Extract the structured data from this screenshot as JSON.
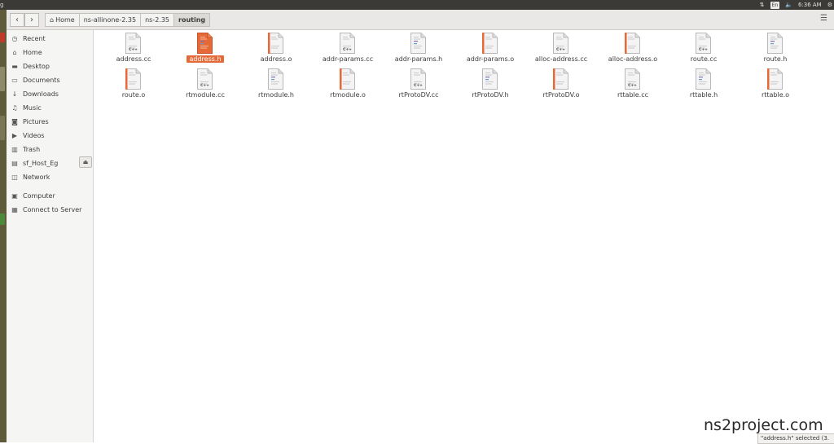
{
  "window": {
    "title_fragment": "g"
  },
  "top_panel": {
    "input_lang": "En",
    "time": "6:36 AM"
  },
  "breadcrumb": [
    {
      "label": "Home",
      "icon": "home-icon"
    },
    {
      "label": "ns-allinone-2.35"
    },
    {
      "label": "ns-2.35"
    },
    {
      "label": "routing"
    }
  ],
  "sidebar": {
    "items": [
      {
        "label": "Recent",
        "icon": "clock-icon"
      },
      {
        "label": "Home",
        "icon": "home-icon"
      },
      {
        "label": "Desktop",
        "icon": "folder-icon"
      },
      {
        "label": "Documents",
        "icon": "document-icon"
      },
      {
        "label": "Downloads",
        "icon": "download-icon"
      },
      {
        "label": "Music",
        "icon": "music-icon"
      },
      {
        "label": "Pictures",
        "icon": "camera-icon"
      },
      {
        "label": "Videos",
        "icon": "video-icon"
      },
      {
        "label": "Trash",
        "icon": "trash-icon"
      },
      {
        "label": "sf_Host_Eg",
        "icon": "drive-icon"
      },
      {
        "label": "Network",
        "icon": "network-icon"
      },
      {
        "label": "Computer",
        "icon": "computer-icon"
      },
      {
        "label": "Connect to Server",
        "icon": "server-icon"
      }
    ]
  },
  "files": [
    {
      "name": "address.cc",
      "type": "cpp"
    },
    {
      "name": "address.h",
      "type": "header",
      "selected": true
    },
    {
      "name": "address.o",
      "type": "object"
    },
    {
      "name": "addr-params.cc",
      "type": "cpp"
    },
    {
      "name": "addr-params.h",
      "type": "header"
    },
    {
      "name": "addr-params.o",
      "type": "object"
    },
    {
      "name": "alloc-address.cc",
      "type": "cpp"
    },
    {
      "name": "alloc-address.o",
      "type": "object"
    },
    {
      "name": "route.cc",
      "type": "cpp"
    },
    {
      "name": "route.h",
      "type": "header"
    },
    {
      "name": "route.o",
      "type": "object"
    },
    {
      "name": "rtmodule.cc",
      "type": "cpp"
    },
    {
      "name": "rtmodule.h",
      "type": "header"
    },
    {
      "name": "rtmodule.o",
      "type": "object"
    },
    {
      "name": "rtProtoDV.cc",
      "type": "cpp"
    },
    {
      "name": "rtProtoDV.h",
      "type": "header"
    },
    {
      "name": "rtProtoDV.o",
      "type": "object"
    },
    {
      "name": "rttable.cc",
      "type": "cpp"
    },
    {
      "name": "rttable.h",
      "type": "header"
    },
    {
      "name": "rttable.o",
      "type": "object"
    }
  ],
  "status_bar": {
    "text": "\"address.h\" selected  (3."
  },
  "watermark": "ns2project.com",
  "colors": {
    "accent": "#e56a37",
    "panel": "#3b3a37",
    "launcher": "#5e5a3a"
  }
}
